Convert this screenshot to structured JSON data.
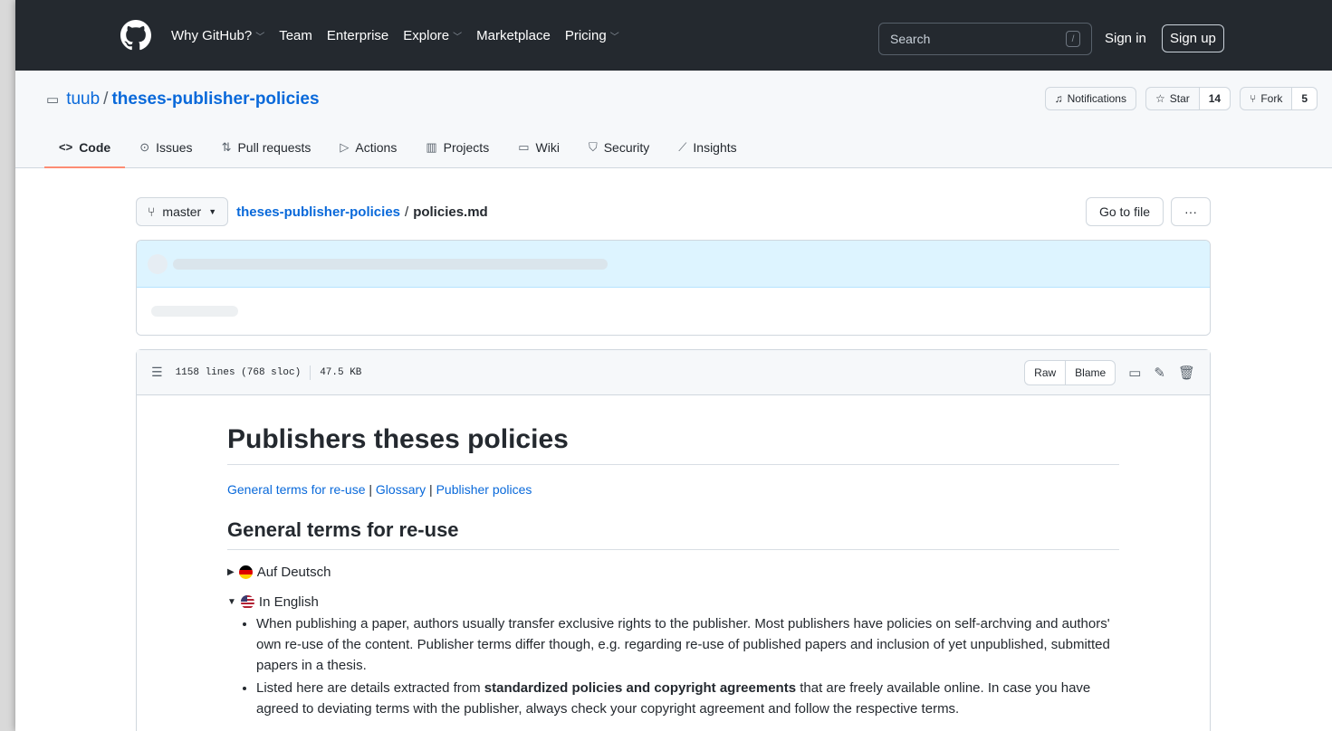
{
  "header": {
    "nav": [
      {
        "label": "Why GitHub?",
        "dropdown": true
      },
      {
        "label": "Team",
        "dropdown": false
      },
      {
        "label": "Enterprise",
        "dropdown": false
      },
      {
        "label": "Explore",
        "dropdown": true
      },
      {
        "label": "Marketplace",
        "dropdown": false
      },
      {
        "label": "Pricing",
        "dropdown": true
      }
    ],
    "search_placeholder": "Search",
    "search_shortcut": "/",
    "signin": "Sign in",
    "signup": "Sign up"
  },
  "repo": {
    "owner": "tuub",
    "separator": "/",
    "name": "theses-publisher-policies",
    "notifications_label": "Notifications",
    "star_label": "Star",
    "star_count": "14",
    "fork_label": "Fork",
    "fork_count": "5",
    "tabs": [
      {
        "label": "Code",
        "icon": "code-icon",
        "glyph": "<>"
      },
      {
        "label": "Issues",
        "icon": "issue-icon",
        "glyph": "⊙"
      },
      {
        "label": "Pull requests",
        "icon": "pull-request-icon",
        "glyph": "⇅"
      },
      {
        "label": "Actions",
        "icon": "play-icon",
        "glyph": "▷"
      },
      {
        "label": "Projects",
        "icon": "project-icon",
        "glyph": "▥"
      },
      {
        "label": "Wiki",
        "icon": "book-icon",
        "glyph": "▭"
      },
      {
        "label": "Security",
        "icon": "shield-icon",
        "glyph": "⛉"
      },
      {
        "label": "Insights",
        "icon": "graph-icon",
        "glyph": "⟋"
      }
    ]
  },
  "file_nav": {
    "branch": "master",
    "repo_link": "theses-publisher-policies",
    "separator": "/",
    "file_name": "policies.md",
    "go_to_file": "Go to file",
    "more": "···"
  },
  "file_header": {
    "lines": "1158 lines (768 sloc)",
    "size": "47.5 KB",
    "raw": "Raw",
    "blame": "Blame"
  },
  "markdown": {
    "h1": "Publishers theses policies",
    "links": [
      "General terms for re-use",
      "Glossary",
      "Publisher polices"
    ],
    "link_sep": " | ",
    "h2": "General terms for re-use",
    "details_de": "Auf Deutsch",
    "details_en": "In English",
    "bullet1": "When publishing a paper, authors usually transfer exclusive rights to the publisher. Most publishers have policies on self-archving and authors' own re-use of the content. Publisher terms differ though, e.g. regarding re-use of published papers and inclusion of yet unpublished, submitted papers in a thesis.",
    "bullet2_pre": "Listed here are details extracted from ",
    "bullet2_bold": "standardized policies and copyright agreements",
    "bullet2_post": " that are freely available online. In case you have agreed to deviating terms with the publisher, always check your copyright agreement and follow the respective terms."
  },
  "colors": {
    "header_bg": "#24292f",
    "link": "#0969da",
    "active_tab_underline": "#fd8c73",
    "commit_bg": "#ddf4ff"
  }
}
